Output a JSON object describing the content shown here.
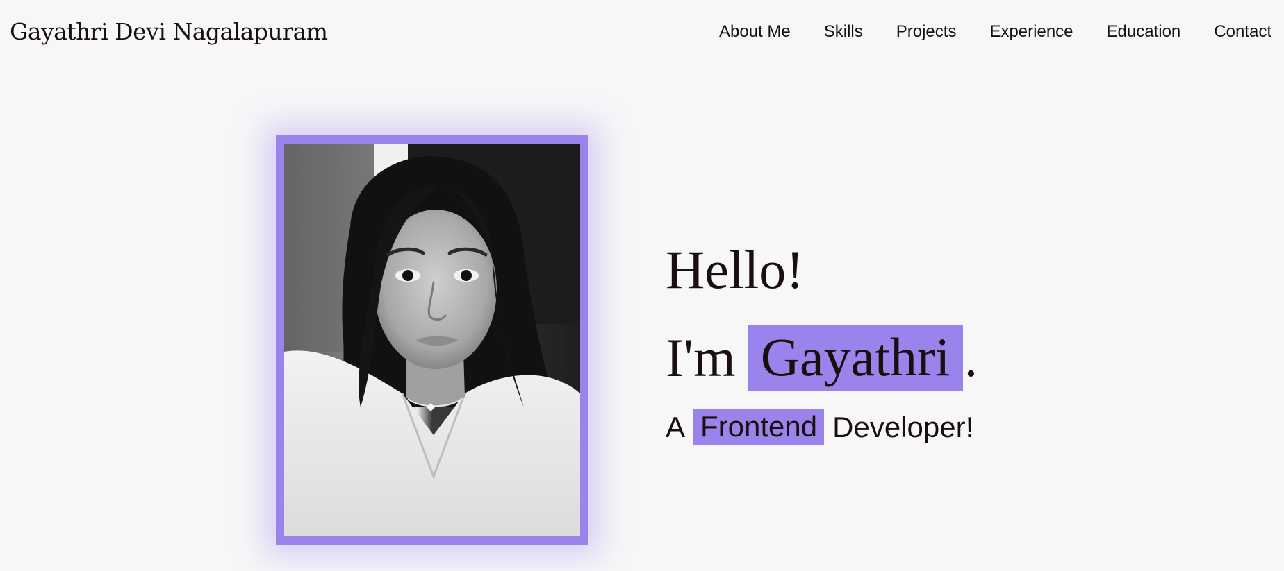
{
  "header": {
    "brand": "Gayathri Devi Nagalapuram",
    "nav": [
      {
        "label": "About Me"
      },
      {
        "label": "Skills"
      },
      {
        "label": "Projects"
      },
      {
        "label": "Experience"
      },
      {
        "label": "Education"
      },
      {
        "label": "Contact"
      }
    ]
  },
  "hero": {
    "greeting": "Hello!",
    "intro_prefix": "I'm",
    "name": "Gayathri",
    "intro_suffix": ".",
    "role_prefix": "A",
    "role_highlight": "Frontend",
    "role_suffix": "Developer!"
  },
  "colors": {
    "accent": "#9a84ec",
    "background": "#f7f7f8",
    "text": "#1a0f0f"
  }
}
